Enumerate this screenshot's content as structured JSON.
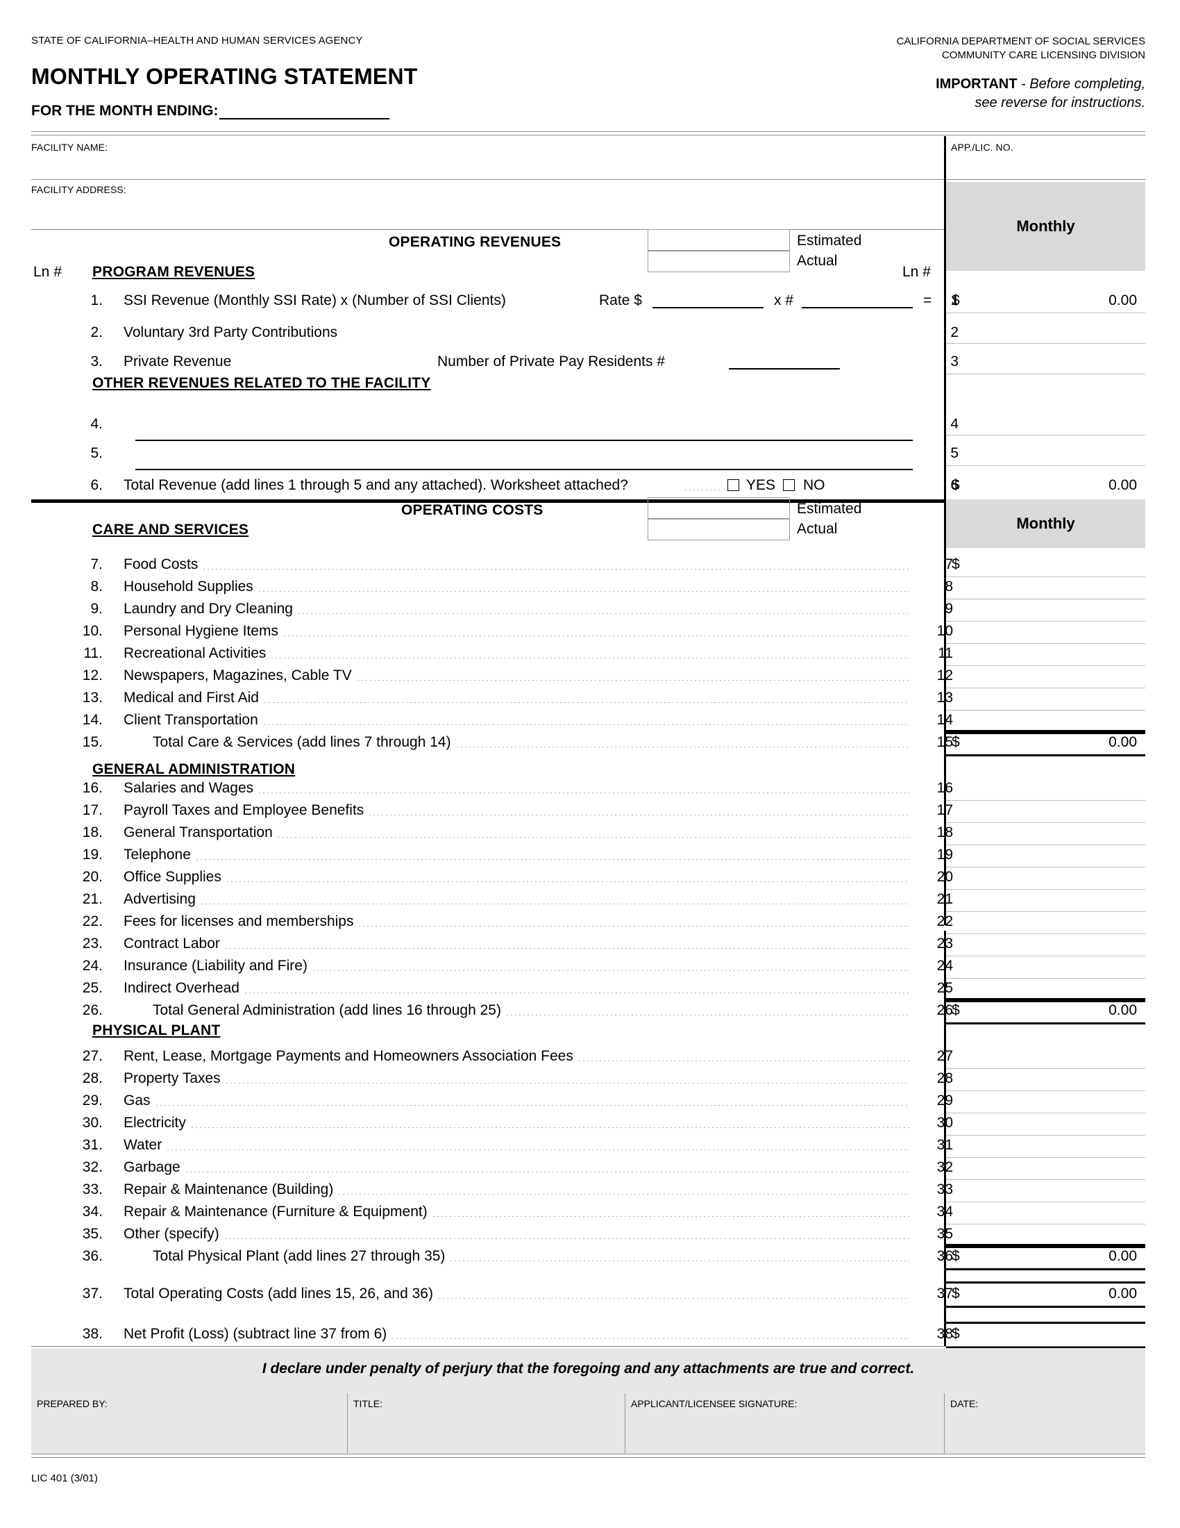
{
  "header": {
    "agency_left": "STATE OF CALIFORNIA–HEALTH AND HUMAN SERVICES AGENCY",
    "dept_line1": "CALIFORNIA DEPARTMENT OF SOCIAL SERVICES",
    "dept_line2": "COMMUNITY CARE LICENSING DIVISION",
    "title": "MONTHLY OPERATING STATEMENT",
    "month_ending_label": "FOR THE MONTH ENDING:",
    "important_bold": "IMPORTANT",
    "important_rest": " - Before completing,",
    "important_line2": "see reverse for instructions."
  },
  "facility": {
    "name_label": "FACILITY NAME:",
    "address_label": "FACILITY ADDRESS:",
    "app_lic_label": "APP./LIC. NO."
  },
  "revenues": {
    "banner": "OPERATING REVENUES",
    "estimated_label": "Estimated",
    "actual_label": "Actual",
    "ln_label_left": "Ln #",
    "ln_label_right": "Ln #",
    "section_heading": "PROGRAM REVENUES",
    "other_heading": "OTHER REVENUES RELATED TO THE FACILITY",
    "monthly_label": "Monthly",
    "lines": [
      {
        "num": "1.",
        "right": "1",
        "text": "SSI Revenue (Monthly SSI Rate) x (Number of SSI Clients)",
        "extra_rate": "Rate $",
        "extra_x": "x #",
        "extra_eq": "= ",
        "dollar": "$",
        "value": "0.00",
        "total": true,
        "has_fill": true
      },
      {
        "num": "2.",
        "right": "2",
        "text": "Voluntary 3rd Party Contributions",
        "dollar": "",
        "value": ""
      },
      {
        "num": "3.",
        "right": "3",
        "text": "Private Revenue",
        "extra_residents": "Number of Private Pay Residents #",
        "dollar": "",
        "value": ""
      },
      {
        "num": "4.",
        "right": "4",
        "text": "",
        "dollar": "",
        "value": "",
        "blank_line": true
      },
      {
        "num": "5.",
        "right": "5",
        "text": "",
        "dollar": "",
        "value": "",
        "blank_line": true
      },
      {
        "num": "6.",
        "right": "6",
        "text": "Total Revenue (add lines 1 through 5 and any attached).  Worksheet attached?",
        "yes": "YES",
        "no": "NO",
        "dollar": "$",
        "value": "0.00",
        "total": true
      }
    ]
  },
  "costs": {
    "banner": "OPERATING COSTS",
    "estimated_label": "Estimated",
    "actual_label": "Actual",
    "monthly_label": "Monthly",
    "care_heading": "CARE AND SERVICES",
    "genadmin_heading": "GENERAL ADMINISTRATION",
    "physplant_heading": "PHYSICAL PLANT",
    "lines": [
      {
        "num": "7.",
        "right": "7",
        "text": "Food Costs",
        "dollar": "$",
        "value": ""
      },
      {
        "num": "8.",
        "right": "8",
        "text": "Household Supplies",
        "dollar": "",
        "value": ""
      },
      {
        "num": "9.",
        "right": "9",
        "text": "Laundry and Dry Cleaning",
        "dollar": "",
        "value": ""
      },
      {
        "num": "10.",
        "right": "10",
        "text": "Personal Hygiene Items",
        "dollar": "",
        "value": ""
      },
      {
        "num": "11.",
        "right": "11",
        "text": "Recreational Activities",
        "dollar": "",
        "value": ""
      },
      {
        "num": "12.",
        "right": "12",
        "text": "Newspapers, Magazines, Cable TV",
        "dollar": "",
        "value": ""
      },
      {
        "num": "13.",
        "right": "13",
        "text": "Medical and First Aid",
        "dollar": "",
        "value": ""
      },
      {
        "num": "14.",
        "right": "14",
        "text": "Client Transportation",
        "dollar": "",
        "value": ""
      },
      {
        "num": "15.",
        "right": "15",
        "text": "Total Care & Services (add lines 7 through 14)",
        "dollar": "$",
        "value": "0.00",
        "total": true,
        "indent": true
      },
      {
        "num": "16.",
        "right": "16",
        "text": "Salaries and Wages",
        "dollar": "",
        "value": ""
      },
      {
        "num": "17.",
        "right": "17",
        "text": "Payroll Taxes and Employee Benefits",
        "dollar": "",
        "value": ""
      },
      {
        "num": "18.",
        "right": "18",
        "text": "General Transportation",
        "dollar": "",
        "value": ""
      },
      {
        "num": "19.",
        "right": "19",
        "text": "Telephone",
        "dollar": "",
        "value": ""
      },
      {
        "num": "20.",
        "right": "20",
        "text": "Office Supplies",
        "dollar": "",
        "value": ""
      },
      {
        "num": "21.",
        "right": "21",
        "text": "Advertising",
        "dollar": "",
        "value": ""
      },
      {
        "num": "22.",
        "right": "22",
        "text": "Fees for licenses and memberships",
        "dollar": "",
        "value": ""
      },
      {
        "num": "23.",
        "right": "23",
        "text": "Contract Labor",
        "dollar": "",
        "value": ""
      },
      {
        "num": "24.",
        "right": "24",
        "text": "Insurance (Liability and Fire)",
        "dollar": "",
        "value": ""
      },
      {
        "num": "25.",
        "right": "25",
        "text": "Indirect Overhead",
        "dollar": "",
        "value": ""
      },
      {
        "num": "26.",
        "right": "26",
        "text": "Total General Administration (add lines 16 through 25)",
        "dollar": "$",
        "value": "0.00",
        "total": true,
        "indent": true
      },
      {
        "num": "27.",
        "right": "27",
        "text": "Rent, Lease, Mortgage Payments and Homeowners Association Fees",
        "dollar": "",
        "value": ""
      },
      {
        "num": "28.",
        "right": "28",
        "text": "Property Taxes",
        "dollar": "",
        "value": ""
      },
      {
        "num": "29.",
        "right": "29",
        "text": "Gas",
        "dollar": "",
        "value": ""
      },
      {
        "num": "30.",
        "right": "30",
        "text": "Electricity",
        "dollar": "",
        "value": ""
      },
      {
        "num": "31.",
        "right": "31",
        "text": "Water",
        "dollar": "",
        "value": ""
      },
      {
        "num": "32.",
        "right": "32",
        "text": "Garbage",
        "dollar": "",
        "value": ""
      },
      {
        "num": "33.",
        "right": "33",
        "text": "Repair & Maintenance (Building)",
        "dollar": "",
        "value": ""
      },
      {
        "num": "34.",
        "right": "34",
        "text": "Repair & Maintenance (Furniture & Equipment)",
        "dollar": "",
        "value": ""
      },
      {
        "num": "35.",
        "right": "35",
        "text": "Other (specify)",
        "dollar": "",
        "value": ""
      },
      {
        "num": "36.",
        "right": "36",
        "text": "Total Physical Plant (add lines 27 through 35)",
        "dollar": "$",
        "value": "0.00",
        "total": true,
        "indent": true
      },
      {
        "num": "37.",
        "right": "37",
        "text": "Total Operating Costs (add lines 15, 26, and 36)",
        "dollar": "$",
        "value": "0.00",
        "total": true
      },
      {
        "num": "38.",
        "right": "38",
        "text": "Net Profit (Loss) (subtract line 37 from 6)",
        "dollar": "$",
        "value": "",
        "total": true
      }
    ]
  },
  "declaration": {
    "text": "I declare under penalty of perjury that the foregoing and any attachments are true and correct.",
    "prepared_by_label": "PREPARED BY:",
    "title_label": "TITLE:",
    "signature_label": "APPLICANT/LICENSEE SIGNATURE:",
    "date_label": "DATE:"
  },
  "footer": {
    "form_code": "LIC 401 (3/01)"
  }
}
